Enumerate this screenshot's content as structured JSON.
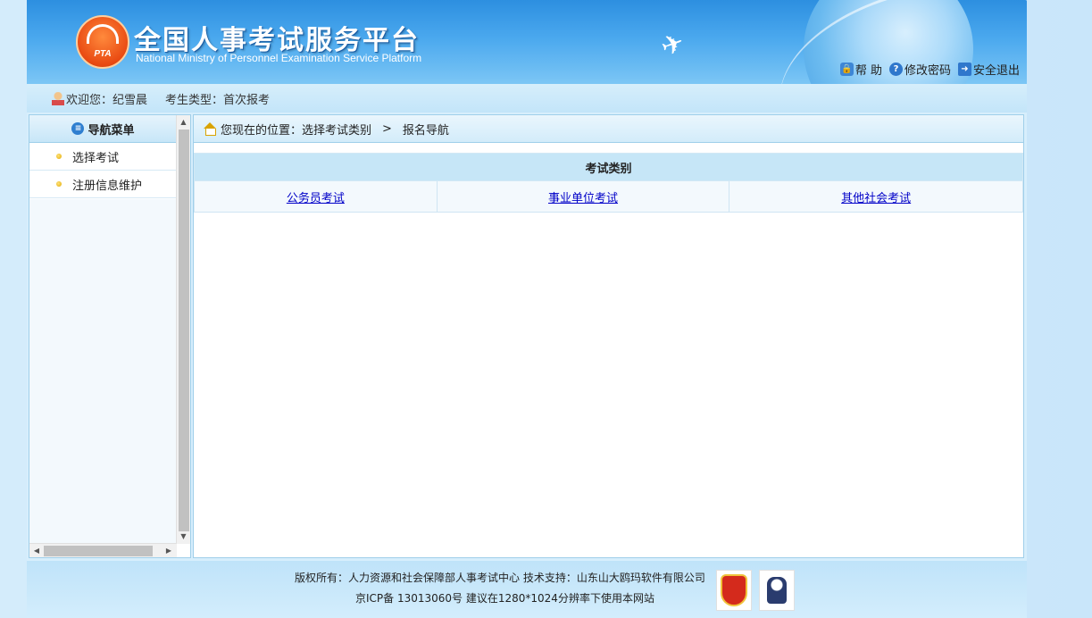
{
  "header": {
    "title": "全国人事考试服务平台",
    "subtitle": "National Ministry of Personnel Examination Service Platform",
    "logo_text": "PTA",
    "links": [
      {
        "label": "帮 助",
        "icon": "lock-icon"
      },
      {
        "label": "修改密码",
        "icon": "help-icon"
      },
      {
        "label": "安全退出",
        "icon": "exit-icon"
      }
    ]
  },
  "userbar": {
    "welcome": "欢迎您：纪雪晨",
    "candidate_type": "考生类型：首次报考"
  },
  "sidebar": {
    "heading": "导航菜单",
    "items": [
      {
        "label": "选择考试"
      },
      {
        "label": "注册信息维护"
      }
    ]
  },
  "breadcrumb": {
    "prefix": "您现在的位置：选择考试类别",
    "separator": ">",
    "current": "报名导航"
  },
  "exam_table": {
    "header": "考试类别",
    "options": [
      "公务员考试",
      "事业单位考试",
      "其他社会考试"
    ]
  },
  "footer": {
    "line1": "版权所有：人力资源和社会保障部人事考试中心  技术支持：山东山大鸥玛软件有限公司",
    "line2": "京ICP备 13013060号  建议在1280*1024分辨率下使用本网站"
  },
  "colors": {
    "header_blue": "#2d8fe0",
    "link_blue": "#0000c8",
    "table_header": "#c6e6f7"
  }
}
